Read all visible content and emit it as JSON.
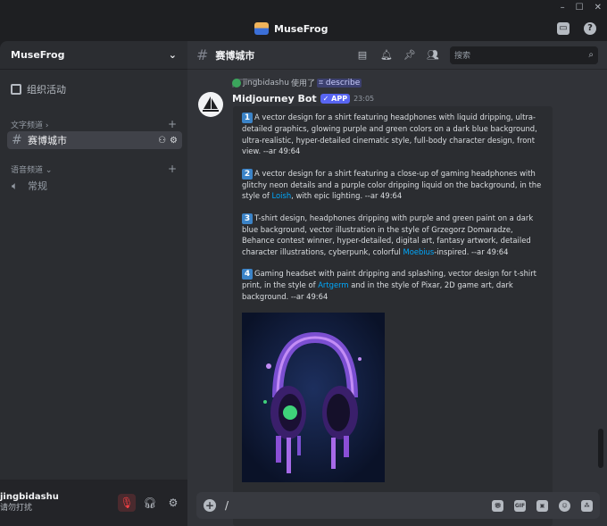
{
  "app": {
    "title": "MuseFrog",
    "accent": "#5865f2"
  },
  "window": {
    "minimize": "–",
    "maximize": "☐",
    "close": "✕"
  },
  "sidebar": {
    "server_name": "MuseFrog",
    "activity": "组织活动",
    "text_category": "文字频道",
    "voice_category": "语音频道",
    "channels": [
      {
        "name": "赛博城市",
        "type": "text",
        "active": true
      },
      {
        "name": "常规",
        "type": "voice",
        "active": false
      }
    ]
  },
  "user": {
    "name": "jingbidashu",
    "status": "请勿打扰"
  },
  "channel_header": {
    "name": "赛博城市",
    "search_placeholder": "搜索"
  },
  "message": {
    "reply_user": "jingbidashu",
    "reply_used": "使用了",
    "reply_command": "⌗ describe",
    "author": "Midjourney Bot",
    "badge": "✓ APP",
    "time": "23:05",
    "prompts": [
      {
        "num": "1",
        "text_before": "A vector design for a shirt featuring headphones with liquid dripping, ultra-detailed graphics, glowing purple and green colors on a dark blue background, ultra-realistic, hyper-detailed cinematic style, full-body character design, front view. --ar 49:64",
        "link": "",
        "text_after": ""
      },
      {
        "num": "2",
        "text_before": "A vector design for a shirt featuring a close-up of gaming headphones with glitchy neon details and a purple color dripping liquid on the background, in the style of ",
        "link": "Loish",
        "text_after": ", with epic lighting. --ar 49:64"
      },
      {
        "num": "3",
        "text_before": "T-shirt design, headphones dripping with purple and green paint on a dark blue background, vector illustration in the style of Grzegorz Domaradze, Behance contest winner, hyper-detailed, digital art, fantasy artwork, detailed character illustrations, cyberpunk, colorful ",
        "link": "Moebius",
        "text_after": "-inspired. --ar 49:64"
      },
      {
        "num": "4",
        "text_before": "Gaming headset with paint dripping and splashing, vector design for t-shirt print, in the style of ",
        "link": "Artgerm",
        "text_after": " and in the style of Pixar, 2D game art, dark background. --ar 49:64"
      }
    ]
  },
  "composer": {
    "text": "/"
  }
}
